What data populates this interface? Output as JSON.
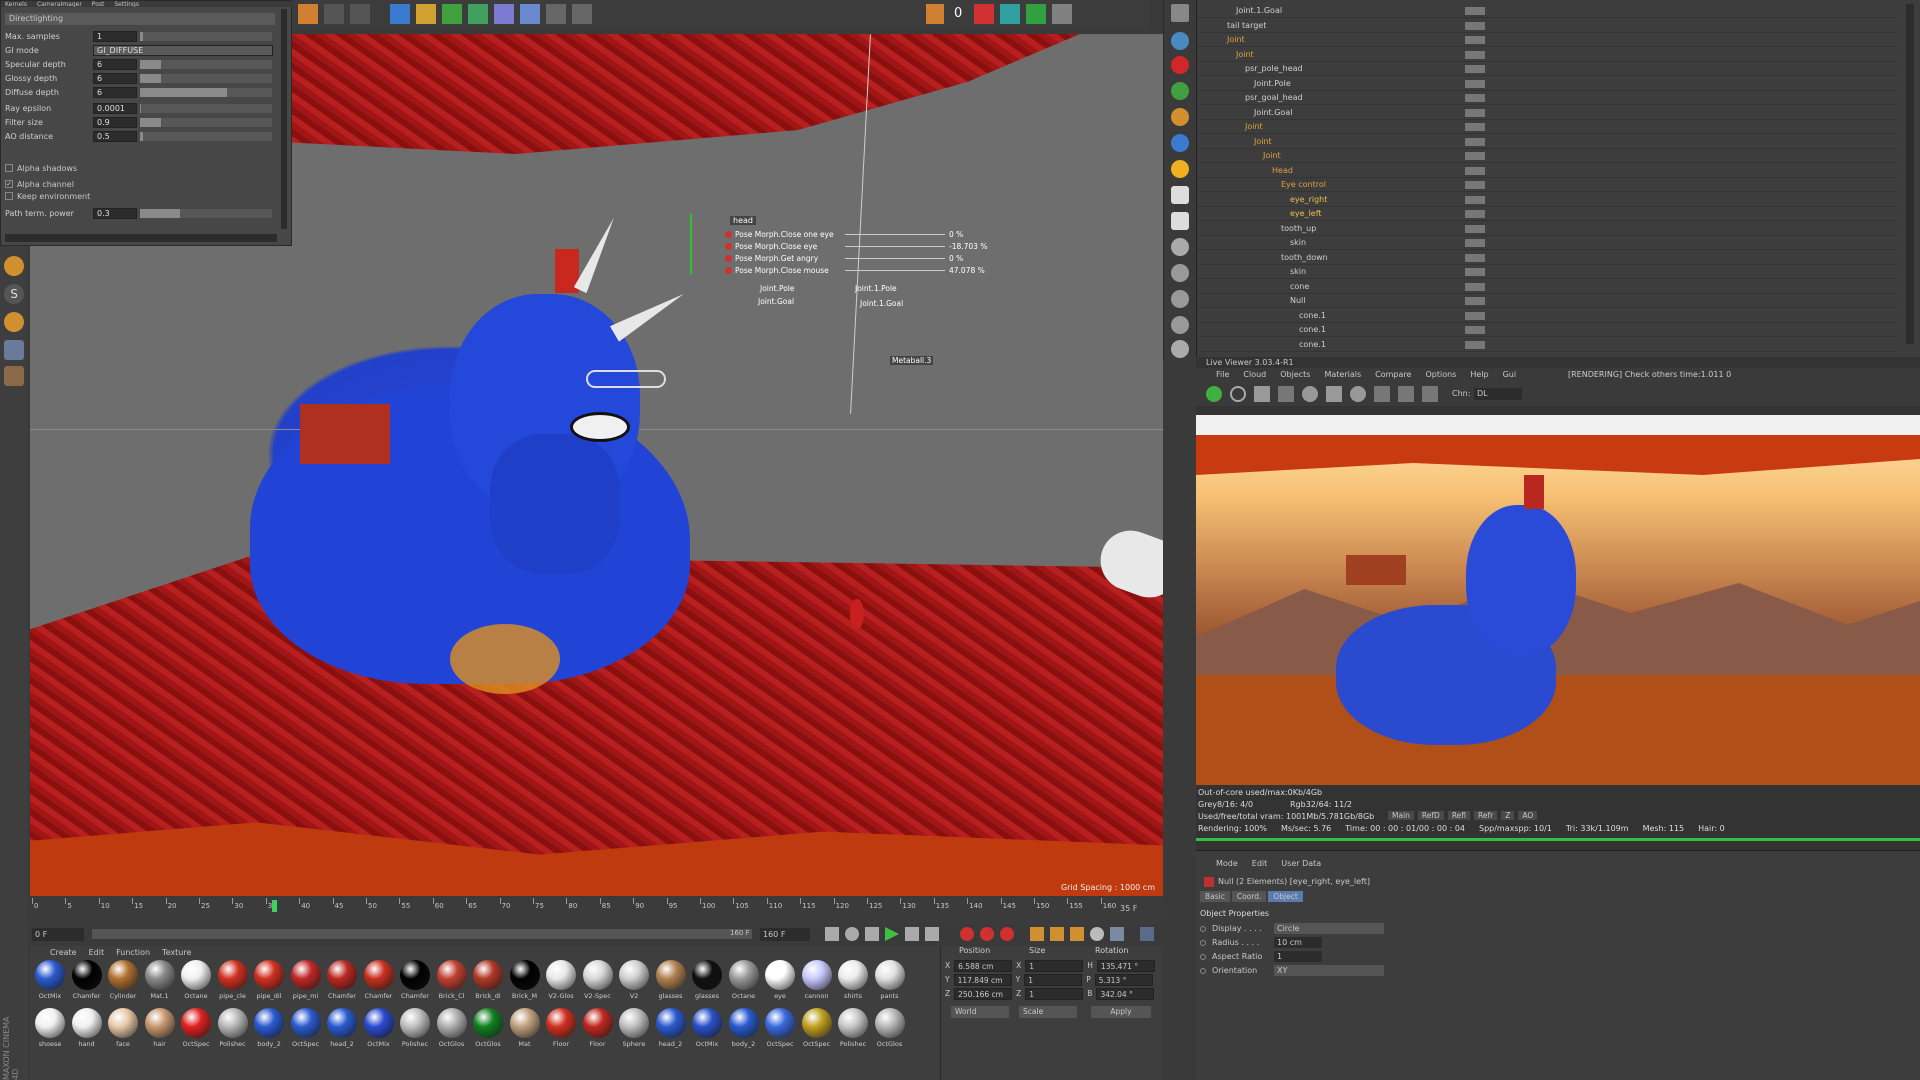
{
  "settings": {
    "tab_labels": [
      "Kernels",
      "CameraImager",
      "Post",
      "Settings"
    ],
    "preset": "Directlighting",
    "rows": [
      {
        "label": "Max. samples",
        "value": "1",
        "fill": 0.02
      },
      {
        "label": "GI mode",
        "value": "GI_DIFFUSE"
      },
      {
        "label": "Specular depth",
        "value": "6",
        "fill": 0.16
      },
      {
        "label": "Glossy depth",
        "value": "6",
        "fill": 0.16
      },
      {
        "label": "Diffuse depth",
        "value": "6",
        "fill": 0.66
      },
      {
        "label": "Ray epsilon",
        "value": "0.0001",
        "fill": 0.01
      },
      {
        "label": "Filter size",
        "value": "0.9",
        "fill": 0.16
      },
      {
        "label": "AO distance",
        "value": "0.5",
        "fill": 0.02
      }
    ],
    "checks": [
      {
        "label": "Alpha shadows",
        "checked": false
      },
      {
        "label": "Alpha channel",
        "checked": true
      },
      {
        "label": "Keep environment",
        "checked": false
      }
    ],
    "path_term": {
      "label": "Path term. power",
      "value": "0.3",
      "fill": 0.3
    }
  },
  "viewport": {
    "grid_spacing": "Grid Spacing : 1000 cm",
    "hud": {
      "head_label": "head",
      "morphs": [
        {
          "label": "Pose Morph.Close one eye",
          "value": "0 %"
        },
        {
          "label": "Pose Morph.Close eye",
          "value": "-18.703 %"
        },
        {
          "label": "Pose Morph.Get angry",
          "value": "0 %"
        },
        {
          "label": "Pose Morph.Close mouse",
          "value": "47.078 %"
        }
      ],
      "tags": [
        "Joint.Pole",
        "Joint.1.Pole",
        "Joint.Goal",
        "Joint.1.Goal",
        "Metaball.3"
      ]
    }
  },
  "topbar": {
    "frame_counter": "0"
  },
  "objects": [
    {
      "name": "Joint.1.Goal",
      "indent": 3,
      "color": "#d0d0d0"
    },
    {
      "name": "tail target",
      "indent": 2,
      "color": "#d0d0d0"
    },
    {
      "name": "Joint",
      "indent": 2,
      "color": "#e0a040"
    },
    {
      "name": "Joint",
      "indent": 3,
      "color": "#e0a040"
    },
    {
      "name": "psr_pole_head",
      "indent": 4,
      "color": "#d0d0d0"
    },
    {
      "name": "Joint.Pole",
      "indent": 5,
      "color": "#d0d0d0"
    },
    {
      "name": "psr_goal_head",
      "indent": 4,
      "color": "#d0d0d0"
    },
    {
      "name": "Joint.Goal",
      "indent": 5,
      "color": "#d0d0d0"
    },
    {
      "name": "Joint",
      "indent": 4,
      "color": "#e0a040"
    },
    {
      "name": "Joint",
      "indent": 5,
      "color": "#e0a040"
    },
    {
      "name": "Joint",
      "indent": 6,
      "color": "#e0a040"
    },
    {
      "name": "Head",
      "indent": 7,
      "color": "#e0a040"
    },
    {
      "name": "Eye control",
      "indent": 8,
      "color": "#e0a040"
    },
    {
      "name": "eye_right",
      "indent": 9,
      "color": "#f0c050"
    },
    {
      "name": "eye_left",
      "indent": 9,
      "color": "#f0c050"
    },
    {
      "name": "tooth_up",
      "indent": 8,
      "color": "#d0d0d0"
    },
    {
      "name": "skin",
      "indent": 9,
      "color": "#d0d0d0"
    },
    {
      "name": "tooth_down",
      "indent": 8,
      "color": "#d0d0d0"
    },
    {
      "name": "skin",
      "indent": 9,
      "color": "#d0d0d0"
    },
    {
      "name": "cone",
      "indent": 9,
      "color": "#d0d0d0"
    },
    {
      "name": "Null",
      "indent": 9,
      "color": "#d0d0d0"
    },
    {
      "name": "cone.1",
      "indent": 10,
      "color": "#d0d0d0"
    },
    {
      "name": "cone.1",
      "indent": 10,
      "color": "#d0d0d0"
    },
    {
      "name": "cone.1",
      "indent": 10,
      "color": "#d0d0d0"
    }
  ],
  "live_viewer": {
    "title": "Live Viewer 3.03.4-R1",
    "menu": [
      "File",
      "Cloud",
      "Objects",
      "Materials",
      "Compare",
      "Options",
      "Help",
      "Gui"
    ],
    "status": "[RENDERING] Check others time:1.011  0",
    "channel_label": "Chn:",
    "channel_value": "DL",
    "outofcore": "Out-of-core used/max:0Kb/4Gb",
    "grey": "Grey8/16: 4/0",
    "rgb": "Rgb32/64: 11/2",
    "vram": "Used/free/total vram: 1001Mb/5.781Gb/8Gb",
    "passes": [
      "Main",
      "RefD",
      "Refl",
      "Refr",
      "Z",
      "AO"
    ],
    "rendering": "Rendering: 100%",
    "mssec": "Ms/sec: 5.76",
    "time": "Time: 00 : 00 : 01/00 : 00 : 04",
    "spp": "Spp/maxspp: 10/1",
    "tri": "Tri: 33k/1.109m",
    "mesh": "Mesh: 115",
    "hair": "Hair: 0"
  },
  "attributes": {
    "menu": [
      "Mode",
      "Edit",
      "User Data"
    ],
    "object_line": "Null (2 Elements) [eye_right, eye_left]",
    "tabs": [
      "Basic",
      "Coord.",
      "Object"
    ],
    "section": "Object Properties",
    "fields": [
      {
        "label": "Display . . . .",
        "value": "Circle"
      },
      {
        "label": "Radius . . . .",
        "value": "10 cm"
      },
      {
        "label": "Aspect Ratio",
        "value": "1"
      },
      {
        "label": "Orientation",
        "value": "XY"
      }
    ]
  },
  "timeline": {
    "ticks": [
      "0",
      "5",
      "10",
      "15",
      "20",
      "25",
      "30",
      "35",
      "40",
      "45",
      "50",
      "55",
      "60",
      "65",
      "70",
      "75",
      "80",
      "85",
      "90",
      "95",
      "100",
      "105",
      "110",
      "115",
      "120",
      "125",
      "130",
      "135",
      "140",
      "145",
      "150",
      "155",
      "160"
    ],
    "end_frame": "35 F",
    "start_field": "0 F",
    "end_field": "160 F",
    "range_end": "160 F"
  },
  "material_menu": [
    "Create",
    "Edit",
    "Function",
    "Texture"
  ],
  "materials_row1": [
    {
      "name": "OctMix",
      "color": "#2a5ad0"
    },
    {
      "name": "Chamfer",
      "color": "#000000"
    },
    {
      "name": "Cylinder",
      "color": "#b07030"
    },
    {
      "name": "Mat.1",
      "color": "#8a8a8a"
    },
    {
      "name": "Octane",
      "color": "#f0f0f0"
    },
    {
      "name": "pipe_cle",
      "color": "#d03020"
    },
    {
      "name": "pipe_dil",
      "color": "#d03020"
    },
    {
      "name": "pipe_mi",
      "color": "#c02828"
    },
    {
      "name": "Chamfer",
      "color": "#b82820"
    },
    {
      "name": "Chamfer",
      "color": "#c83020"
    },
    {
      "name": "Chamfer",
      "color": "#000000"
    },
    {
      "name": "Brick_Cl",
      "color": "#c04030"
    },
    {
      "name": "Brick_di",
      "color": "#b03828"
    },
    {
      "name": "Brick_M",
      "color": "#000000"
    },
    {
      "name": "V2-Glos",
      "color": "#e8e8e8"
    },
    {
      "name": "V2-Spec",
      "color": "#d8d8d8"
    },
    {
      "name": "V2",
      "color": "#d0d0d0"
    },
    {
      "name": "glasses",
      "color": "#b08050"
    },
    {
      "name": "glasses",
      "color": "#101010"
    },
    {
      "name": "Octane",
      "color": "#9a9a9a"
    },
    {
      "name": "eye",
      "color": "#ffffff"
    },
    {
      "name": "cannon",
      "color": "#c8c8ff"
    },
    {
      "name": "shirts",
      "color": "#ececec"
    },
    {
      "name": "pants",
      "color": "#e0e0e0"
    }
  ],
  "materials_row2": [
    {
      "name": "shoese",
      "color": "#f0f0f0"
    },
    {
      "name": "hand",
      "color": "#f0f0f0"
    },
    {
      "name": "face",
      "color": "#e8c8a8"
    },
    {
      "name": "hair",
      "color": "#c89870"
    },
    {
      "name": "OctSpec",
      "color": "#e02020"
    },
    {
      "name": "Polishec",
      "color": "#b8b8b8"
    },
    {
      "name": "body_2",
      "color": "#2a5ad0"
    },
    {
      "name": "OctSpec",
      "color": "#2a5ad0"
    },
    {
      "name": "head_2",
      "color": "#2a5ad0"
    },
    {
      "name": "OctMix",
      "color": "#2a4ad0"
    },
    {
      "name": "Polishec",
      "color": "#c0c0c0"
    },
    {
      "name": "OctGlos",
      "color": "#b0b0b0"
    },
    {
      "name": "OctGlos",
      "color": "#108020"
    },
    {
      "name": "Mat",
      "color": "#c0a080"
    },
    {
      "name": "Floor",
      "color": "#d03020"
    },
    {
      "name": "Floor",
      "color": "#c02820"
    },
    {
      "name": "Sphere",
      "color": "#c0c0c0"
    },
    {
      "name": "head_2",
      "color": "#2a5ad0"
    },
    {
      "name": "OctMix",
      "color": "#2a50c8"
    },
    {
      "name": "body_2",
      "color": "#2a5ad0"
    },
    {
      "name": "OctSpec",
      "color": "#3a6ae0"
    },
    {
      "name": "OctSpec",
      "color": "#c0a020"
    },
    {
      "name": "Polishec",
      "color": "#c8c8c8"
    },
    {
      "name": "OctGlos",
      "color": "#b8b8b8"
    }
  ],
  "coords": {
    "headers": [
      "Position",
      "Size",
      "Rotation"
    ],
    "rows": [
      {
        "axis": "X",
        "pos": "6.588 cm",
        "size_axis": "X",
        "size": "1",
        "rot_axis": "H",
        "rot": "135.471 °"
      },
      {
        "axis": "Y",
        "pos": "117.849 cm",
        "size_axis": "Y",
        "size": "1",
        "rot_axis": "P",
        "rot": "5.313 °"
      },
      {
        "axis": "Z",
        "pos": "250.166 cm",
        "size_axis": "Z",
        "size": "1",
        "rot_axis": "B",
        "rot": "342.04 °"
      }
    ],
    "world": "World",
    "scale": "Scale",
    "apply": "Apply"
  },
  "branding": "MAXON CINEMA 4D"
}
